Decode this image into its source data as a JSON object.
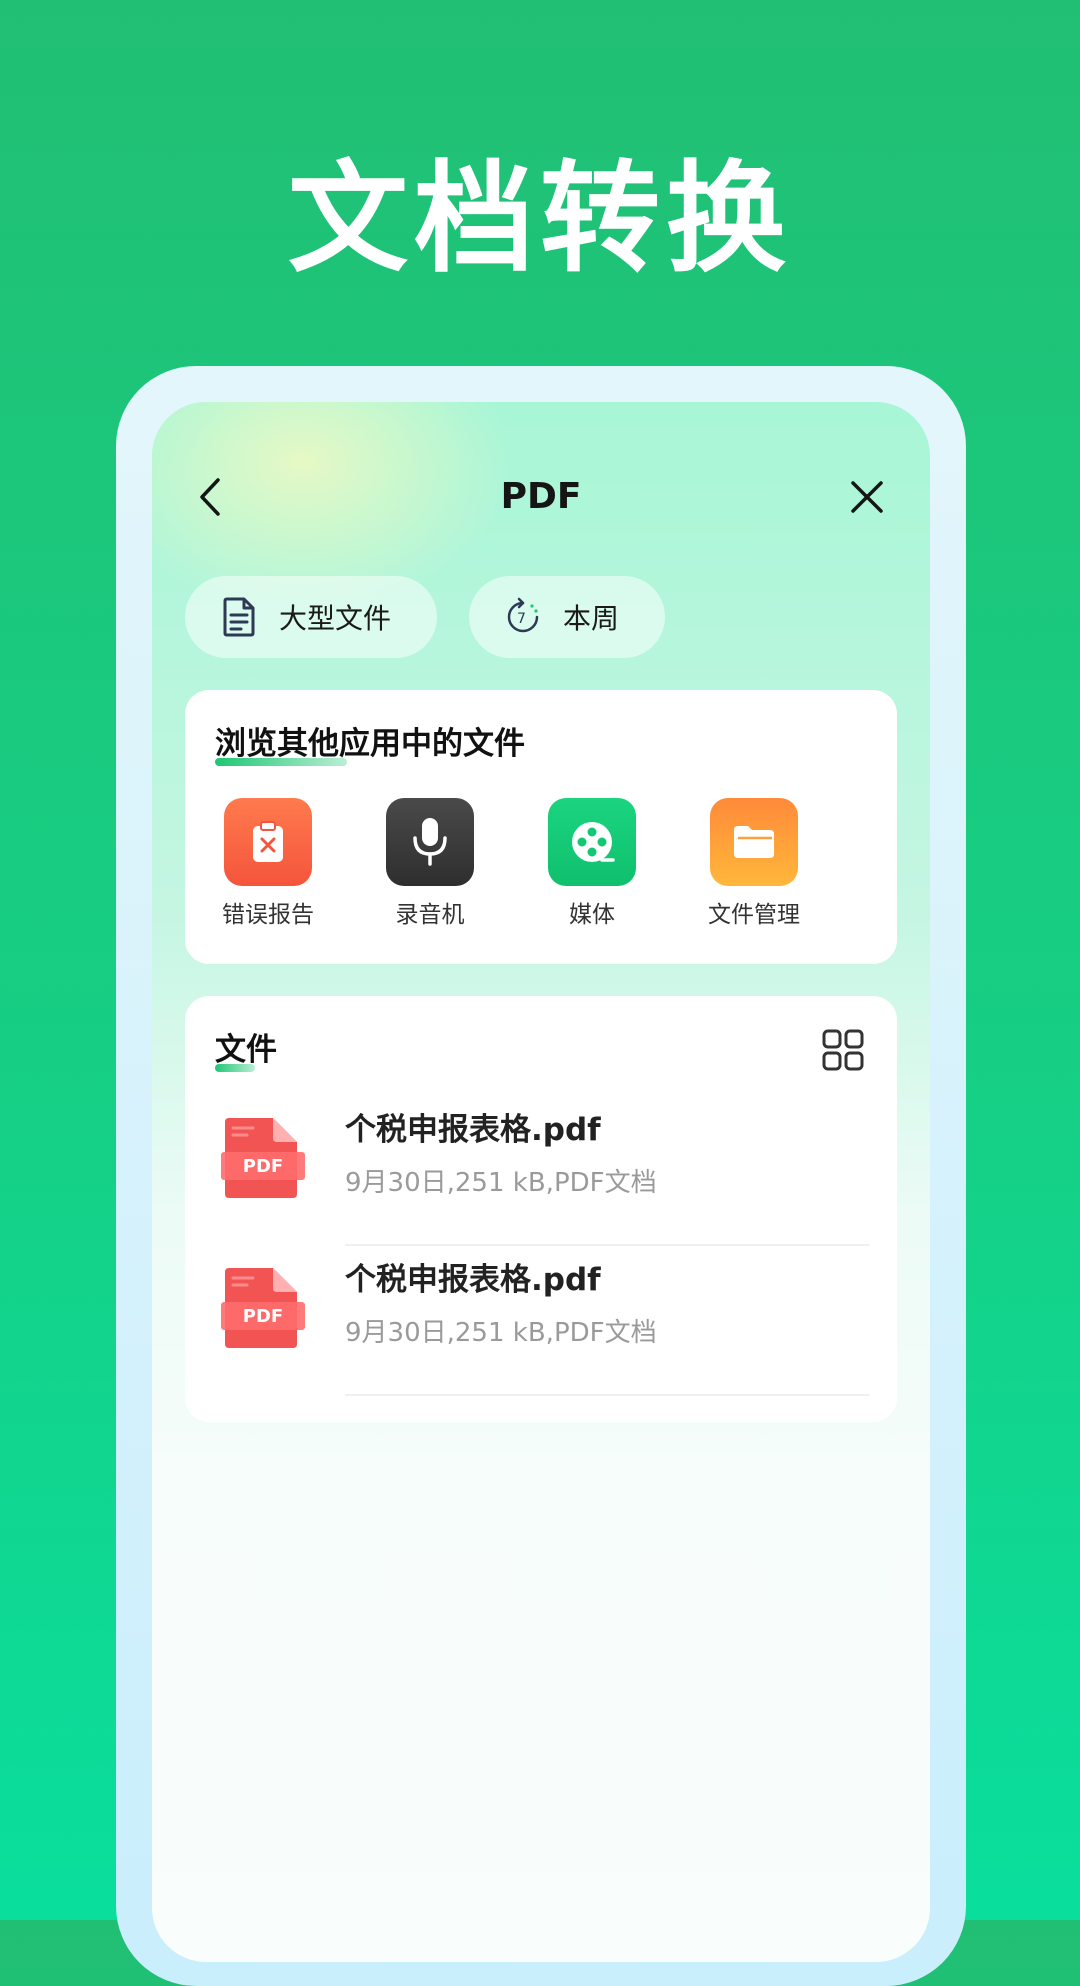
{
  "hero": {
    "title": "文档转换"
  },
  "topbar": {
    "title": "PDF",
    "back_icon": "chevron-left-icon",
    "close_icon": "close-icon"
  },
  "filters": [
    {
      "label": "大型文件",
      "icon": "document-icon"
    },
    {
      "label": "本周",
      "icon": "calendar-7-icon"
    }
  ],
  "browse": {
    "title": "浏览其他应用中的文件",
    "apps": [
      {
        "label": "错误报告",
        "icon": "clipboard-x-icon",
        "color": "#f5673f"
      },
      {
        "label": "录音机",
        "icon": "microphone-icon",
        "color": "#3a3a3a"
      },
      {
        "label": "媒体",
        "icon": "film-reel-icon",
        "color": "#12c877"
      },
      {
        "label": "文件管理",
        "icon": "folder-icon",
        "color": "#ff9a2b"
      }
    ]
  },
  "files": {
    "title": "文件",
    "view_toggle_icon": "grid-view-icon",
    "items": [
      {
        "name": "个税申报表格.pdf",
        "meta": "9月30日,251 kB,PDF文档",
        "badge": "PDF"
      },
      {
        "name": "个税申报表格.pdf",
        "meta": "9月30日,251 kB,PDF文档",
        "badge": "PDF"
      }
    ]
  },
  "colors": {
    "brand_green": "#21bf73",
    "pdf_red": "#f25454",
    "accent": "#1fc675"
  }
}
